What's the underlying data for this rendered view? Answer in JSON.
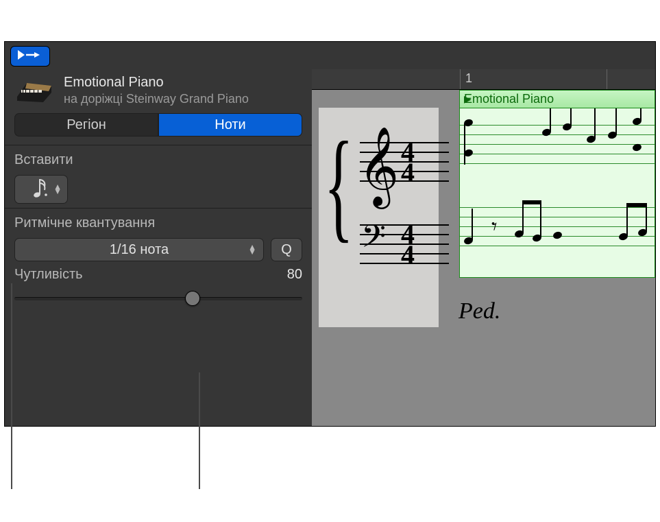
{
  "header": {
    "region_title": "Emotional Piano",
    "region_subtitle": "на доріжці Steinway Grand Piano"
  },
  "tabs": {
    "region": "Регіон",
    "notes": "Ноти"
  },
  "insert": {
    "label": "Вставити",
    "note_value_icon": "sixteenth-note-icon"
  },
  "quantize": {
    "label": "Ритмічне квантування",
    "value": "1/16 нота",
    "button": "Q"
  },
  "sensitivity": {
    "label": "Чутливість",
    "value": "80",
    "slider_percent": 62
  },
  "score": {
    "ruler_marker": "1",
    "region_name": "Emotional Piano",
    "time_signature": {
      "num": "4",
      "den": "4"
    },
    "pedal_text": "Ped."
  }
}
